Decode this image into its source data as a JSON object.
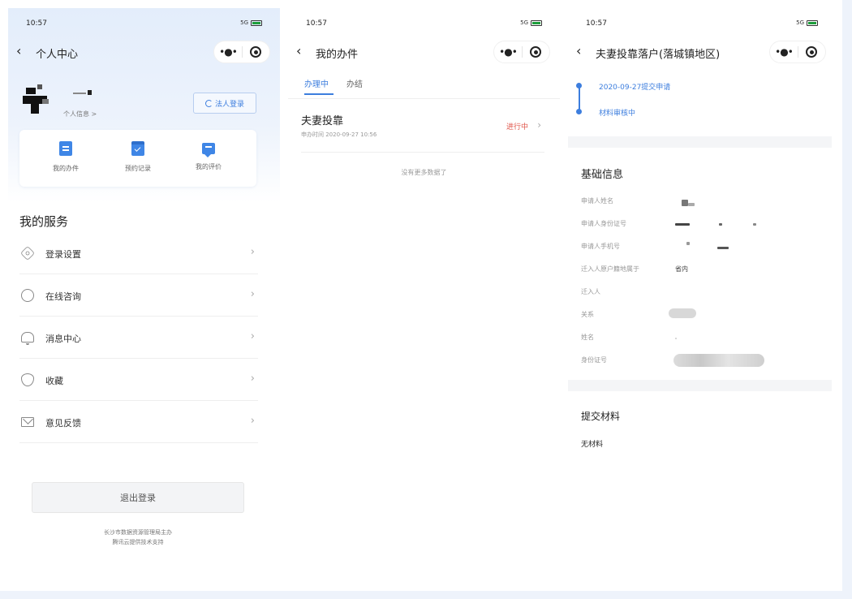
{
  "panel1": {
    "status": {
      "time": "10:57",
      "signal": "5G"
    },
    "nav": {
      "title": "个人中心"
    },
    "user": {
      "info_link": "个人信息 >"
    },
    "corp_login": "法人登录",
    "quick": [
      {
        "label": "我的办件",
        "icon": "document-icon"
      },
      {
        "label": "预约记录",
        "icon": "calendar-icon"
      },
      {
        "label": "我的评价",
        "icon": "comment-icon"
      }
    ],
    "section_title": "我的服务",
    "services": [
      {
        "label": "登录设置",
        "icon": "settings-icon"
      },
      {
        "label": "在线咨询",
        "icon": "chat-icon"
      },
      {
        "label": "消息中心",
        "icon": "bell-icon"
      },
      {
        "label": "收藏",
        "icon": "heart-icon"
      },
      {
        "label": "意见反馈",
        "icon": "mail-icon"
      }
    ],
    "logout": "退出登录",
    "footer": [
      "长沙市数据资源管理局主办",
      "腾讯云提供技术支持"
    ]
  },
  "panel2": {
    "status": {
      "time": "10:57",
      "signal": "5G"
    },
    "nav": {
      "title": "我的办件"
    },
    "tabs": [
      "办理中",
      "办结"
    ],
    "case": {
      "title": "夫妻投靠",
      "time": "申办时间 2020-09-27 10:56",
      "status": "进行中"
    },
    "no_more": "没有更多数据了"
  },
  "panel3": {
    "status": {
      "time": "10:57",
      "signal": "5G"
    },
    "nav": {
      "title": "夫妻投靠落户(落城镇地区)"
    },
    "timeline": [
      "2020-09-27提交申请",
      "材料审核中"
    ],
    "basic_title": "基础信息",
    "fields": [
      {
        "label": "申请人姓名",
        "value": ""
      },
      {
        "label": "申请人身份证号",
        "value": ""
      },
      {
        "label": "申请人手机号",
        "value": ""
      },
      {
        "label": "迁入人原户籍地属于",
        "value": "省内"
      },
      {
        "label": "迁入人",
        "value": ""
      },
      {
        "label": "关系",
        "value": ""
      },
      {
        "label": "姓名",
        "value": ""
      },
      {
        "label": "身份证号",
        "value": ""
      }
    ],
    "materials_title": "提交材料",
    "materials_value": "无材料"
  },
  "colors": {
    "accent": "#3d7ede",
    "status_red": "#e0564b",
    "header_bg": "#e3edfb"
  }
}
